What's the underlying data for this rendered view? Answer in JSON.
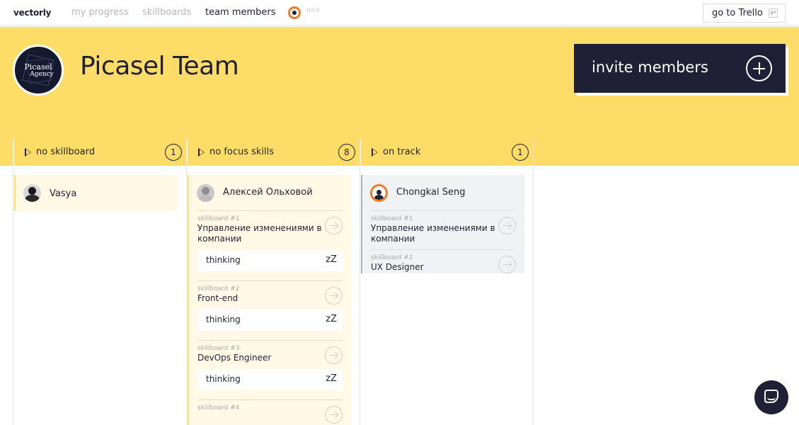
{
  "nav": {
    "brand": "vectorly",
    "links": [
      "my progress",
      "skillboards",
      "team members"
    ],
    "more": "ooo",
    "trello_label": "go to Trello"
  },
  "team": {
    "logo_line1": "Picasel",
    "logo_line2": "Agency",
    "name": "Picasel Team",
    "invite_label": "invite members"
  },
  "columns": [
    {
      "title": "no skillboard",
      "count": "1",
      "members": [
        {
          "name": "Vasya",
          "skills": []
        }
      ]
    },
    {
      "title": "no focus skills",
      "count": "8",
      "members": [
        {
          "name": "Алексей Ольховой",
          "skills": [
            {
              "num": "skillboard #1",
              "name": "Управление изменениями в компании",
              "status": "thinking"
            },
            {
              "num": "skillboard #2",
              "name": "Front-end",
              "status": "thinking"
            },
            {
              "num": "skillboard #3",
              "name": "DevOps Engineer",
              "status": "thinking"
            },
            {
              "num": "skillboard #4",
              "name": ""
            }
          ]
        }
      ]
    },
    {
      "title": "on track",
      "count": "1",
      "members": [
        {
          "name": "Chongkal Seng",
          "skills": [
            {
              "num": "skillboard #1",
              "name": "Управление изменениями в компании"
            },
            {
              "num": "skillboard #2",
              "name": "UX Designer"
            }
          ]
        }
      ]
    }
  ],
  "icons": {
    "status": "zZ"
  },
  "colors": {
    "accent_yellow": "#fddc67",
    "dark_navy": "#1f2035",
    "avatar_ring": "#f07b22"
  }
}
